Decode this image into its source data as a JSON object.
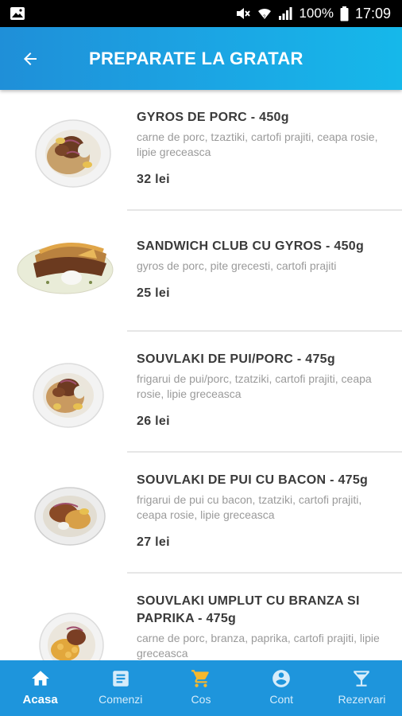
{
  "status_bar": {
    "battery": "100%",
    "time": "17:09",
    "icons": [
      "image-icon",
      "mute-icon",
      "wifi-icon",
      "signal-icon",
      "battery-icon"
    ]
  },
  "header": {
    "title": "PREPARATE LA GRATAR",
    "back_icon": "arrow-back-icon"
  },
  "colors": {
    "primary": "#1e95dc",
    "header_gradient_start": "#1f8fd8",
    "header_gradient_end": "#16b8ea",
    "title_text": "#3a3a3a",
    "desc_text": "#9a9a9a",
    "cart_accent": "#f5b82e"
  },
  "items": [
    {
      "title": "GYROS DE PORC - 450g",
      "description": "carne de porc, tzaztiki, cartofi prajiti, ceapa rosie, lipie greceasca",
      "price": "32 lei"
    },
    {
      "title": "SANDWICH CLUB CU GYROS - 450g",
      "description": "gyros de porc, pite grecesti, cartofi prajiti",
      "price": "25 lei"
    },
    {
      "title": "SOUVLAKI DE PUI/PORC - 475g",
      "description": "frigarui de pui/porc, tzatziki, cartofi prajiti, ceapa rosie, lipie greceasca",
      "price": "26 lei"
    },
    {
      "title": "SOUVLAKI DE PUI CU BACON - 475g",
      "description": "frigarui de pui cu bacon, tzatziki, cartofi prajiti, ceapa rosie, lipie greceasca",
      "price": "27 lei"
    },
    {
      "title": "SOUVLAKI UMPLUT CU BRANZA SI PAPRIKA - 475g",
      "description": "carne de porc, branza, paprika, cartofi prajiti, lipie greceasca",
      "price": ""
    }
  ],
  "bottom_nav": {
    "items": [
      {
        "label": "Acasa",
        "icon": "home-icon",
        "active": true
      },
      {
        "label": "Comenzi",
        "icon": "orders-icon",
        "active": false
      },
      {
        "label": "Cos",
        "icon": "cart-icon",
        "active": false
      },
      {
        "label": "Cont",
        "icon": "account-icon",
        "active": false
      },
      {
        "label": "Rezervari",
        "icon": "cocktail-icon",
        "active": false
      }
    ]
  }
}
